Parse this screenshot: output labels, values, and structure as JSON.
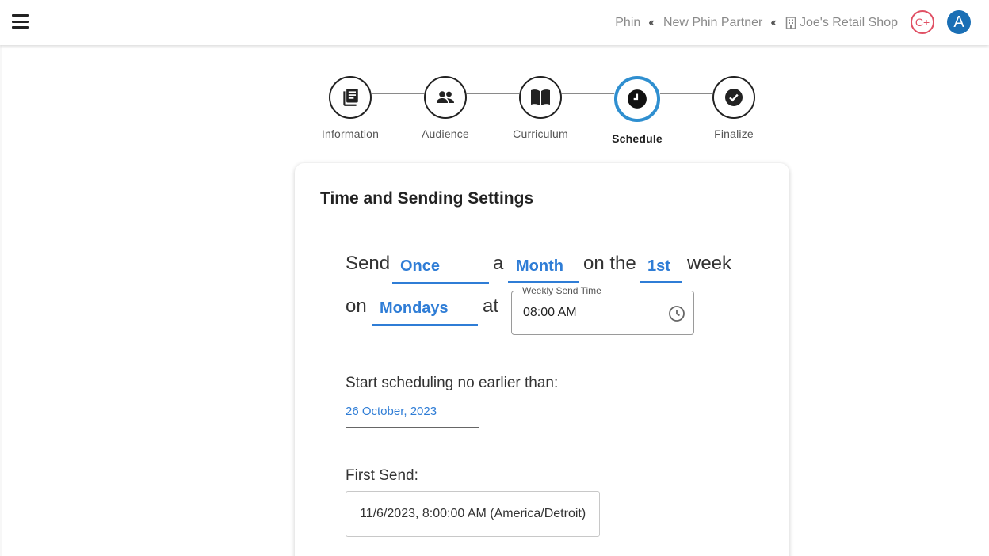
{
  "breadcrumbs": [
    {
      "label": "Phin"
    },
    {
      "label": "New Phin Partner"
    },
    {
      "label": "Joe's Retail Shop"
    }
  ],
  "badge": "C+",
  "avatar_initial": "A",
  "colors": {
    "accent": "#2f7dd6",
    "active_step_ring": "#2f8fd0",
    "badge": "#e05064",
    "avatar": "#1a6fb5"
  },
  "stepper": [
    {
      "label": "Information",
      "icon": "document-icon",
      "active": false
    },
    {
      "label": "Audience",
      "icon": "people-icon",
      "active": false
    },
    {
      "label": "Curriculum",
      "icon": "book-icon",
      "active": false
    },
    {
      "label": "Schedule",
      "icon": "clock-icon",
      "active": true
    },
    {
      "label": "Finalize",
      "icon": "check-icon",
      "active": false
    }
  ],
  "card": {
    "title": "Time and Sending Settings",
    "sentence": {
      "send": "Send",
      "frequency": "Once",
      "a": "a",
      "period": "Month",
      "on_the": "on the",
      "ordinal": "1st",
      "week": "week",
      "on": "on",
      "day": "Mondays",
      "at": "at"
    },
    "time_field": {
      "label": "Weekly Send Time",
      "value": "08:00 AM"
    },
    "start_label": "Start scheduling no earlier than:",
    "start_date": "26 October, 2023",
    "first_send_label": "First Send:",
    "first_send_value": "11/6/2023, 8:00:00 AM (America/Detroit)"
  }
}
